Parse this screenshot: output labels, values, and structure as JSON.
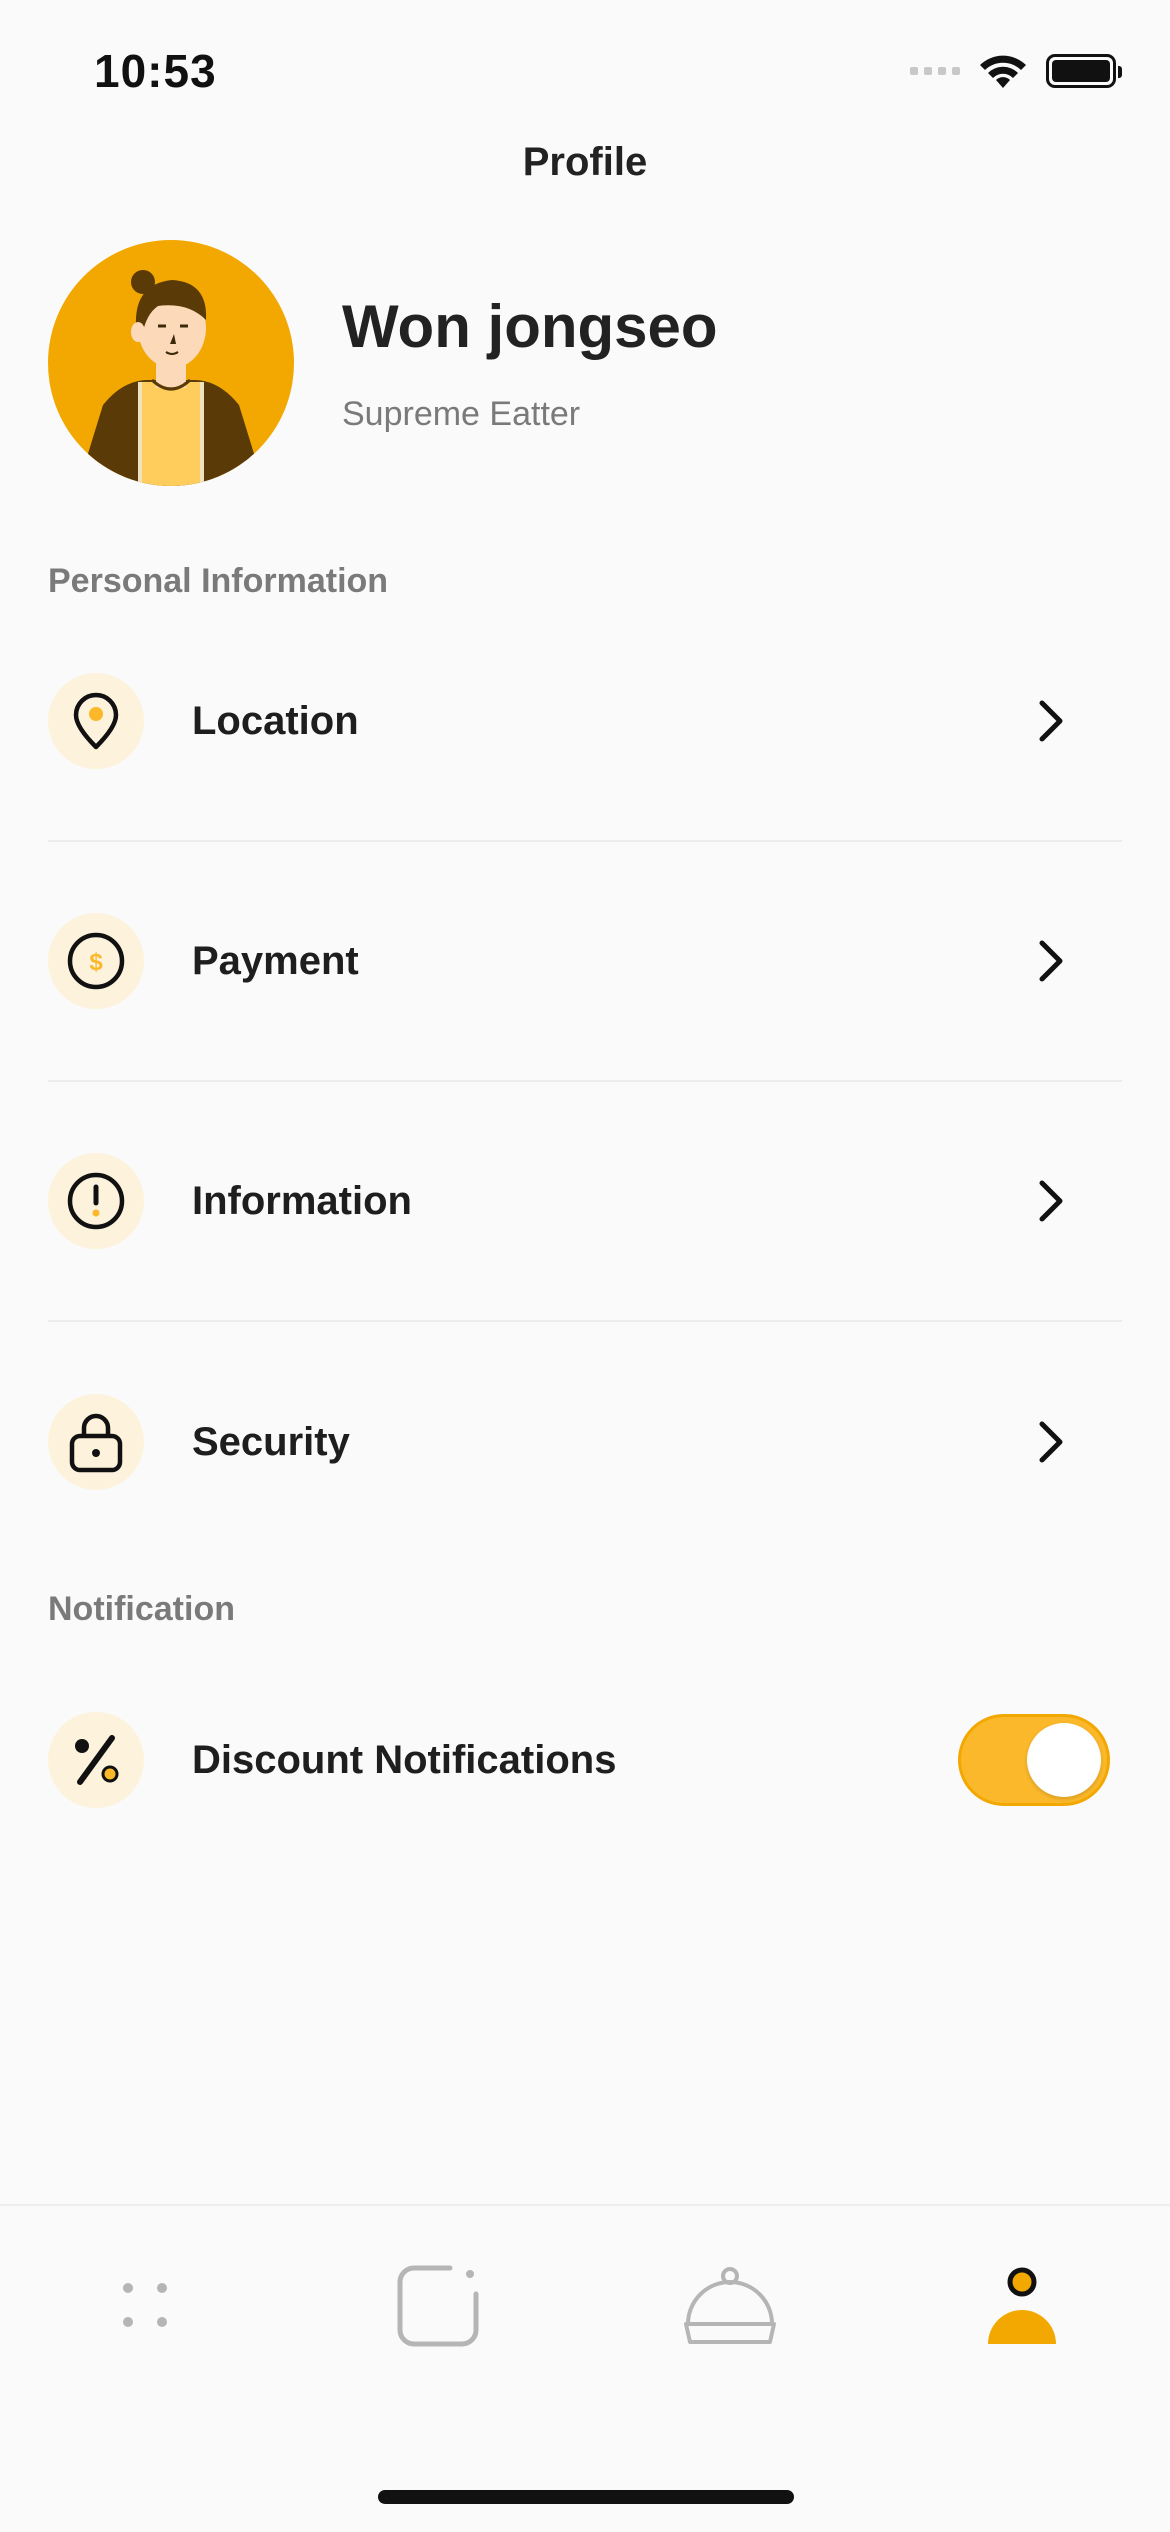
{
  "status_bar": {
    "time": "10:53"
  },
  "header": {
    "title": "Profile"
  },
  "profile": {
    "name": "Won jongseo",
    "subtitle": "Supreme Eatter"
  },
  "sections": {
    "personal": {
      "title": "Personal Information",
      "items": [
        {
          "label": "Location",
          "icon": "location-pin-icon"
        },
        {
          "label": "Payment",
          "icon": "coin-dollar-icon"
        },
        {
          "label": "Information",
          "icon": "info-alert-icon"
        },
        {
          "label": "Security",
          "icon": "lock-icon"
        }
      ]
    },
    "notification": {
      "title": "Notification",
      "items": [
        {
          "label": "Discount Notifications",
          "icon": "percent-icon",
          "toggle_on": true
        }
      ]
    }
  },
  "tab_bar": {
    "tabs": [
      {
        "icon": "grid-dots-icon",
        "active": false
      },
      {
        "icon": "square-badge-icon",
        "active": false
      },
      {
        "icon": "food-cloche-icon",
        "active": false
      },
      {
        "icon": "profile-user-icon",
        "active": true
      }
    ]
  },
  "colors": {
    "accent": "#f2a800",
    "accent_light": "#fdf2dc",
    "toggle": "#fbb82a",
    "muted": "#7a7a7a"
  }
}
